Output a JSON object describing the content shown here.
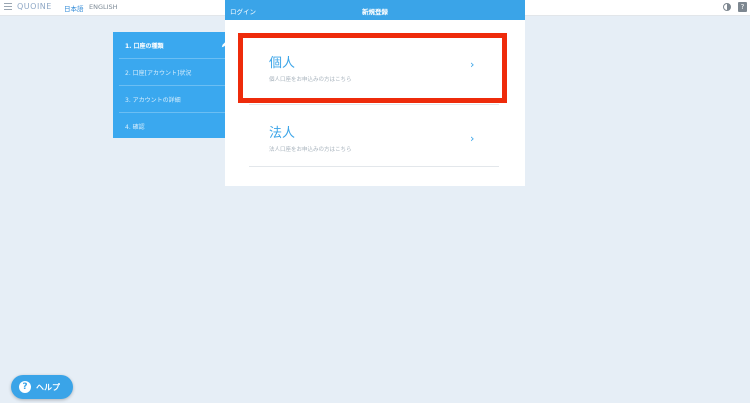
{
  "topbar": {
    "logo": "QUOINE",
    "lang_ja": "日本語",
    "lang_en": "ENGLISH",
    "help_icon_glyph": "?"
  },
  "header": {
    "login": "ログイン",
    "title": "新規登録"
  },
  "steps": [
    {
      "label": "1. 口座の種類",
      "active": true
    },
    {
      "label": "2. 口座[アカウント]状況",
      "active": false
    },
    {
      "label": "3. アカウントの詳細",
      "active": false
    },
    {
      "label": "4. 確認",
      "active": false
    }
  ],
  "options": [
    {
      "title": "個人",
      "subtitle": "個人口座をお申込みの方はこちら",
      "chevron": "›"
    },
    {
      "title": "法人",
      "subtitle": "法人口座をお申込みの方はこちら",
      "chevron": "›"
    }
  ],
  "help": {
    "label": "ヘルプ",
    "icon_glyph": "?"
  },
  "colors": {
    "accent": "#3aa4e8",
    "background": "#e6eef6",
    "highlight": "#ee2b0b"
  },
  "icons": [
    "menu-icon",
    "theme-toggle-icon",
    "help-icon",
    "pencil-icon",
    "chevron-right-icon"
  ]
}
